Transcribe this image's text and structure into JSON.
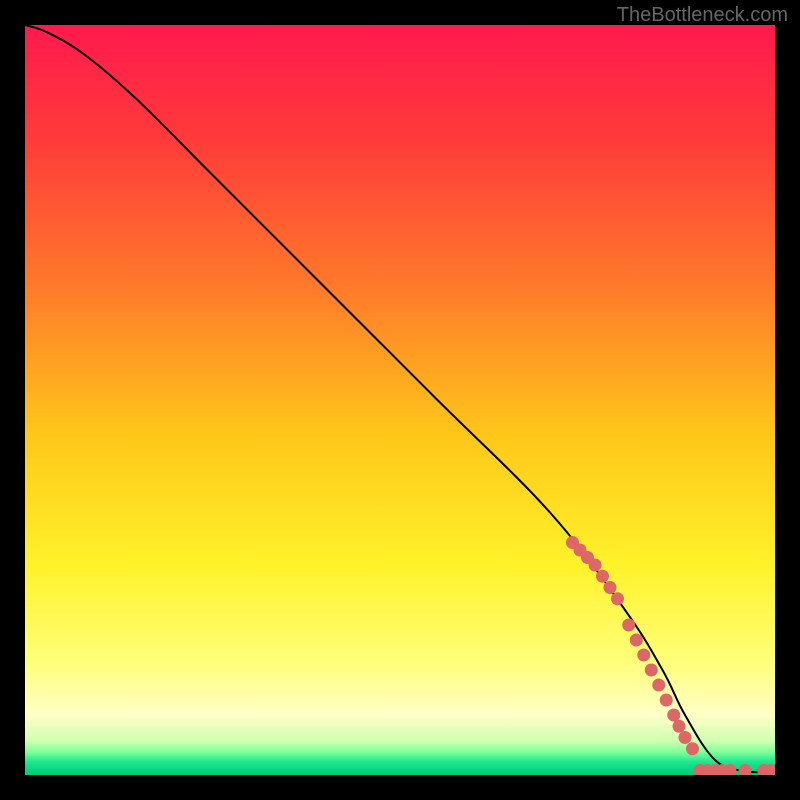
{
  "watermark": "TheBottleneck.com",
  "chart_data": {
    "type": "line",
    "title": "",
    "xlabel": "",
    "ylabel": "",
    "xlim": [
      0,
      100
    ],
    "ylim": [
      0,
      100
    ],
    "series": [
      {
        "name": "bottleneck-curve",
        "x": [
          0,
          3,
          8,
          15,
          25,
          40,
          55,
          70,
          80,
          85,
          88,
          92,
          96,
          100
        ],
        "y": [
          100,
          99,
          96,
          90,
          80,
          65,
          50,
          35,
          22,
          14,
          8,
          2,
          0.5,
          0.5
        ]
      }
    ],
    "markers": {
      "name": "data-points",
      "color": "#d66",
      "points": [
        {
          "x": 73,
          "y": 31
        },
        {
          "x": 74,
          "y": 30
        },
        {
          "x": 75,
          "y": 29
        },
        {
          "x": 76,
          "y": 28
        },
        {
          "x": 77,
          "y": 26.5
        },
        {
          "x": 78,
          "y": 25
        },
        {
          "x": 79,
          "y": 23.5
        },
        {
          "x": 80.5,
          "y": 20
        },
        {
          "x": 81.5,
          "y": 18
        },
        {
          "x": 82.5,
          "y": 16
        },
        {
          "x": 83.5,
          "y": 14
        },
        {
          "x": 84.5,
          "y": 12
        },
        {
          "x": 85.5,
          "y": 10
        },
        {
          "x": 86.5,
          "y": 8
        },
        {
          "x": 87.2,
          "y": 6.5
        },
        {
          "x": 88,
          "y": 5
        },
        {
          "x": 89,
          "y": 3.5
        },
        {
          "x": 90,
          "y": 0.6
        },
        {
          "x": 91,
          "y": 0.6
        },
        {
          "x": 92,
          "y": 0.6
        },
        {
          "x": 93,
          "y": 0.6
        },
        {
          "x": 94,
          "y": 0.6
        },
        {
          "x": 96,
          "y": 0.6
        },
        {
          "x": 98.5,
          "y": 0.6
        },
        {
          "x": 99.5,
          "y": 0.6
        }
      ]
    },
    "gradient_stops": [
      {
        "offset": 0,
        "color": "#ff1a4d"
      },
      {
        "offset": 15,
        "color": "#ff3a3a"
      },
      {
        "offset": 35,
        "color": "#ff7a2a"
      },
      {
        "offset": 55,
        "color": "#ffc81a"
      },
      {
        "offset": 72,
        "color": "#fff22a"
      },
      {
        "offset": 85,
        "color": "#ffff7a"
      },
      {
        "offset": 92,
        "color": "#ffffc8"
      },
      {
        "offset": 95.5,
        "color": "#cfffb0"
      },
      {
        "offset": 97,
        "color": "#7aff9a"
      },
      {
        "offset": 98.2,
        "color": "#20e890"
      },
      {
        "offset": 100,
        "color": "#00c878"
      }
    ]
  }
}
